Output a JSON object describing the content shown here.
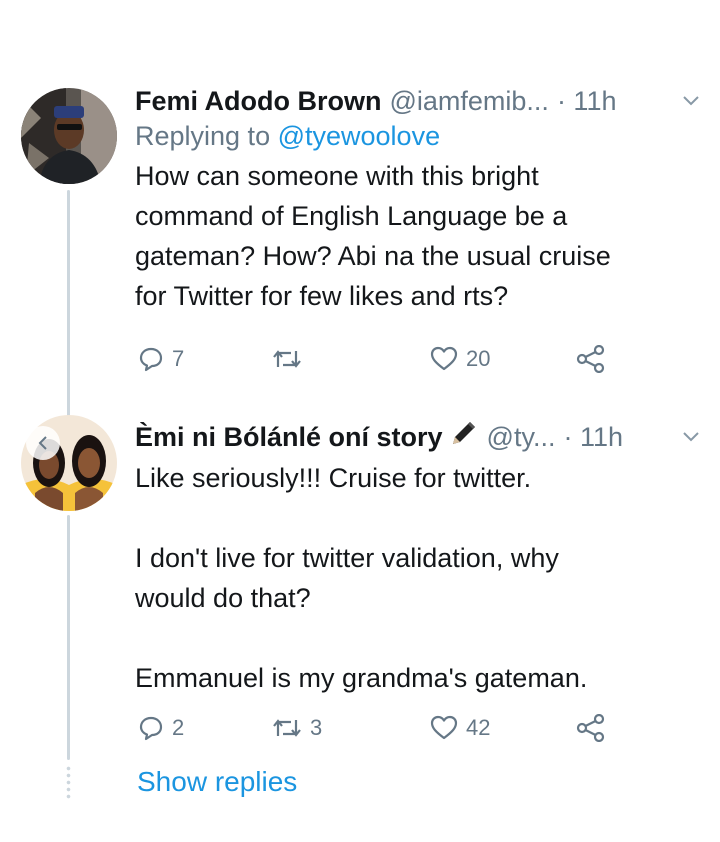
{
  "tweets": [
    {
      "name": "Femi Adodo Brown",
      "handle": "@iamfemib...",
      "time": "· 11h",
      "replying_label": "Replying to ",
      "replying_to": "@tyewoolove",
      "text": "How can someone with this bright\ncommand of English Language be a\ngateman? How? Abi na the usual cruise\nfor Twitter for few likes and rts?",
      "replies": "7",
      "retweets": "",
      "likes": "20"
    },
    {
      "name": "Èmi ni Bólánlé oní story",
      "handle": "@ty...",
      "time": "· 11h",
      "text": "Like seriously!!! Cruise for twitter.\n\nI don't live for twitter validation, why\nwould do that?\n\nEmmanuel is my grandma's gateman.",
      "replies": "2",
      "retweets": "3",
      "likes": "42"
    }
  ],
  "show_replies": "Show replies",
  "icons": {
    "reply": "reply-icon",
    "retweet": "retweet-icon",
    "like": "heart-icon",
    "share": "share-icon",
    "caret": "chevron-down-icon",
    "pen": "pen-emoji-icon"
  },
  "colors": {
    "link": "#1b95e0",
    "muted": "#657786",
    "text": "#14171a",
    "thread": "#ccd6dd"
  }
}
